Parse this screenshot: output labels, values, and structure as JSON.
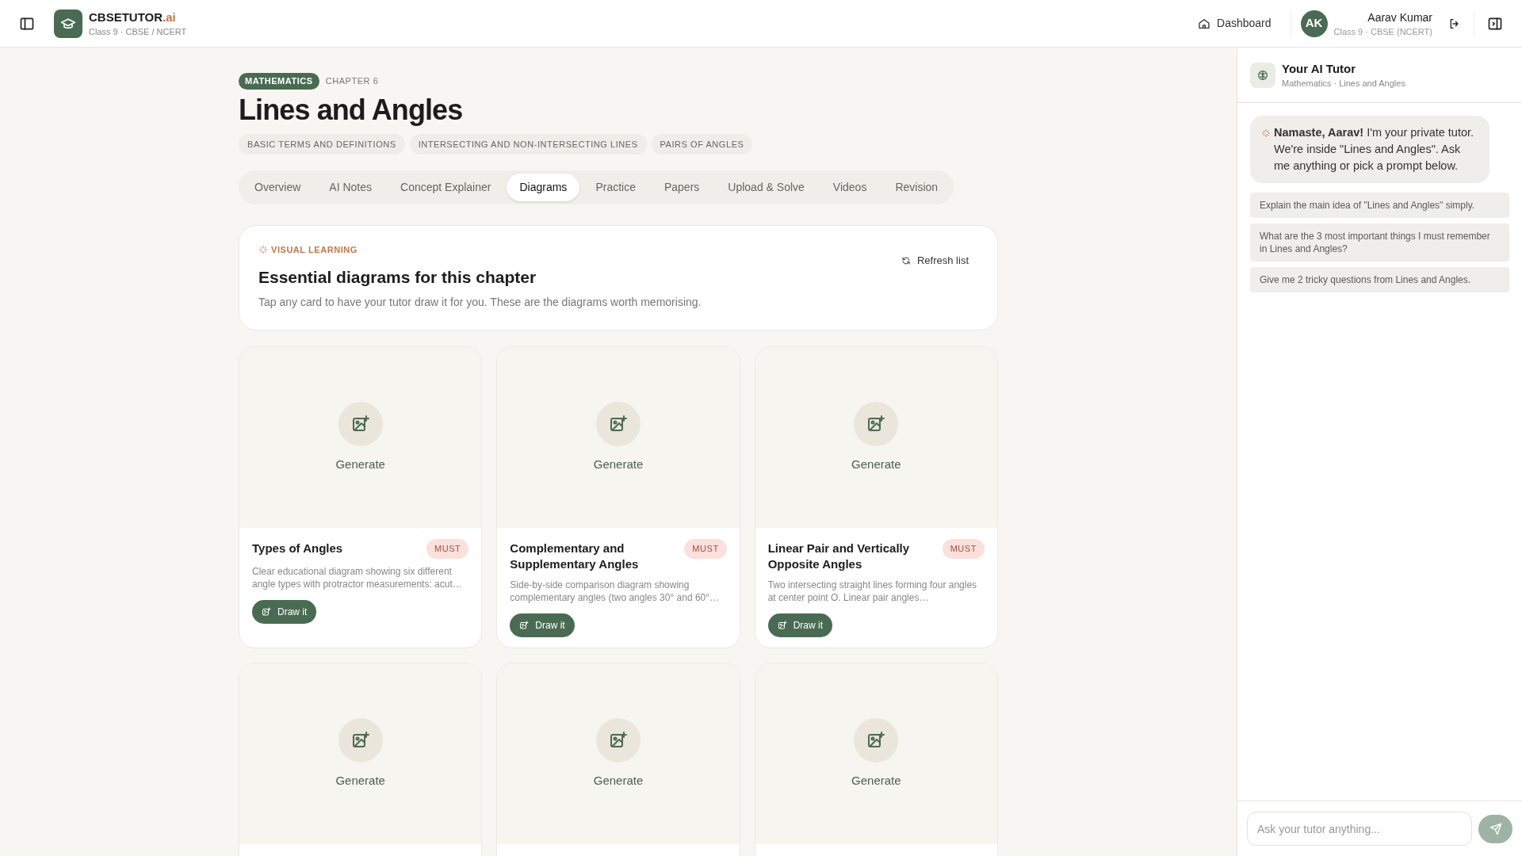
{
  "header": {
    "brand": "CBSETUTOR",
    "brand_suffix": ".ai",
    "subtitle": "Class 9 · CBSE / NCERT",
    "dashboard": "Dashboard",
    "user": {
      "initials": "AK",
      "name": "Aarav Kumar",
      "detail": "Class 9 · CBSE (NCERT)"
    }
  },
  "chapter": {
    "subject": "MATHEMATICS",
    "number": "CHAPTER 6",
    "title": "Lines and Angles",
    "topics": [
      "BASIC TERMS AND DEFINITIONS",
      "INTERSECTING AND NON-INTERSECTING LINES",
      "PAIRS OF ANGLES"
    ]
  },
  "tabs": [
    {
      "label": "Overview",
      "selected": false
    },
    {
      "label": "AI Notes",
      "selected": false
    },
    {
      "label": "Concept Explainer",
      "selected": false
    },
    {
      "label": "Diagrams",
      "selected": true
    },
    {
      "label": "Practice",
      "selected": false
    },
    {
      "label": "Papers",
      "selected": false
    },
    {
      "label": "Upload & Solve",
      "selected": false
    },
    {
      "label": "Videos",
      "selected": false
    },
    {
      "label": "Revision",
      "selected": false
    }
  ],
  "intro": {
    "eyebrow": "VISUAL LEARNING",
    "title": "Essential diagrams for this chapter",
    "text": "Tap any card to have your tutor draw it for you. These are the diagrams worth memorising.",
    "refresh": "Refresh list"
  },
  "cards": [
    {
      "kind": "full",
      "generate": "Generate",
      "title": "Types of Angles",
      "badge": "MUST",
      "description": "Clear educational diagram showing six different angle types with protractor measurements: acut…",
      "action": "Draw it"
    },
    {
      "kind": "full",
      "generate": "Generate",
      "title": "Complementary and Supplementary Angles",
      "badge": "MUST",
      "description": "Side-by-side comparison diagram showing complementary angles (two angles 30° and 60°…",
      "action": "Draw it"
    },
    {
      "kind": "full",
      "generate": "Generate",
      "title": "Linear Pair and Vertically Opposite Angles",
      "badge": "MUST",
      "description": "Two intersecting straight lines forming four angles at center point O. Linear pair angles…",
      "action": "Draw it"
    },
    {
      "kind": "cut",
      "generate": "Generate"
    },
    {
      "kind": "cut",
      "generate": "Generate"
    },
    {
      "kind": "cut",
      "generate": "Generate"
    }
  ],
  "tutor": {
    "title": "Your AI Tutor",
    "subtitle": "Mathematics · Lines and Angles",
    "greeting": "**Namaste, Aarav!** I'm your private tutor. We're inside \"Lines and Angles\". Ask me anything or pick a prompt below.",
    "prompts": [
      "Explain the main idea of \"Lines and Angles\" simply.",
      "What are the 3 most important things I must remember in Lines and Angles?",
      "Give me 2 tricky questions from Lines and Angles."
    ],
    "input": {
      "placeholder": "Ask your tutor anything..."
    }
  }
}
